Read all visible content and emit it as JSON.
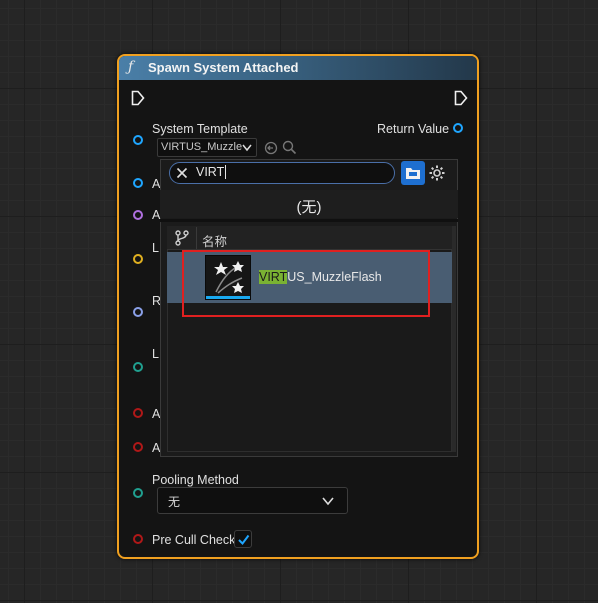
{
  "node": {
    "title": "Spawn System Attached",
    "func_icon": "ƒ",
    "inputs": {
      "system_template_label": "System Template",
      "system_template_value": "VIRTUS_Muzzle",
      "a1": "A",
      "a2": "A",
      "l1": "L",
      "r1": "R",
      "l2": "L",
      "a3": "A",
      "a4": "A",
      "pooling_method_label": "Pooling Method",
      "pooling_method_value": "无",
      "pre_cull_check_label": "Pre Cull Check",
      "pre_cull_check_checked": true
    },
    "outputs": {
      "return_value_label": "Return Value"
    }
  },
  "picker": {
    "search_value": "VIRT",
    "none_option": "(无)",
    "column_header": "名称",
    "results": [
      {
        "name_highlight": "VIRT",
        "name_rest": "US_MuzzleFlash"
      }
    ]
  },
  "colors": {
    "node_border": "#f0a020",
    "header_start": "#4a7fa8",
    "search_highlight": "#7ab233",
    "selection": "#495d72",
    "annotation_box": "#e02020"
  }
}
